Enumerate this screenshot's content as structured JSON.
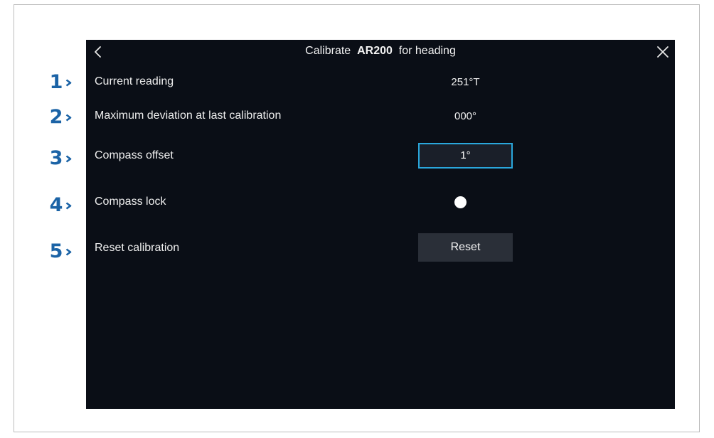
{
  "window": {
    "title_prefix": "Calibrate",
    "title_device": "AR200",
    "title_suffix": "for heading"
  },
  "rows": {
    "current_reading": {
      "label": "Current reading",
      "value": "251°T"
    },
    "max_deviation": {
      "label": "Maximum deviation at last calibration",
      "value": "000°"
    },
    "compass_offset": {
      "label": "Compass offset",
      "value": "1°"
    },
    "compass_lock": {
      "label": "Compass lock",
      "state": "on"
    },
    "reset_calibration": {
      "label": "Reset calibration",
      "button": "Reset"
    }
  },
  "callouts": [
    "1",
    "2",
    "3",
    "4",
    "5"
  ],
  "icons": {
    "back": "chevron-left-icon",
    "close": "close-icon",
    "callout_arrow": "chevron-right-icon"
  },
  "colors": {
    "screen_bg": "#0a0e16",
    "accent": "#2aa7dc",
    "callout": "#1b63a6",
    "button_bg": "#2a2f38"
  }
}
